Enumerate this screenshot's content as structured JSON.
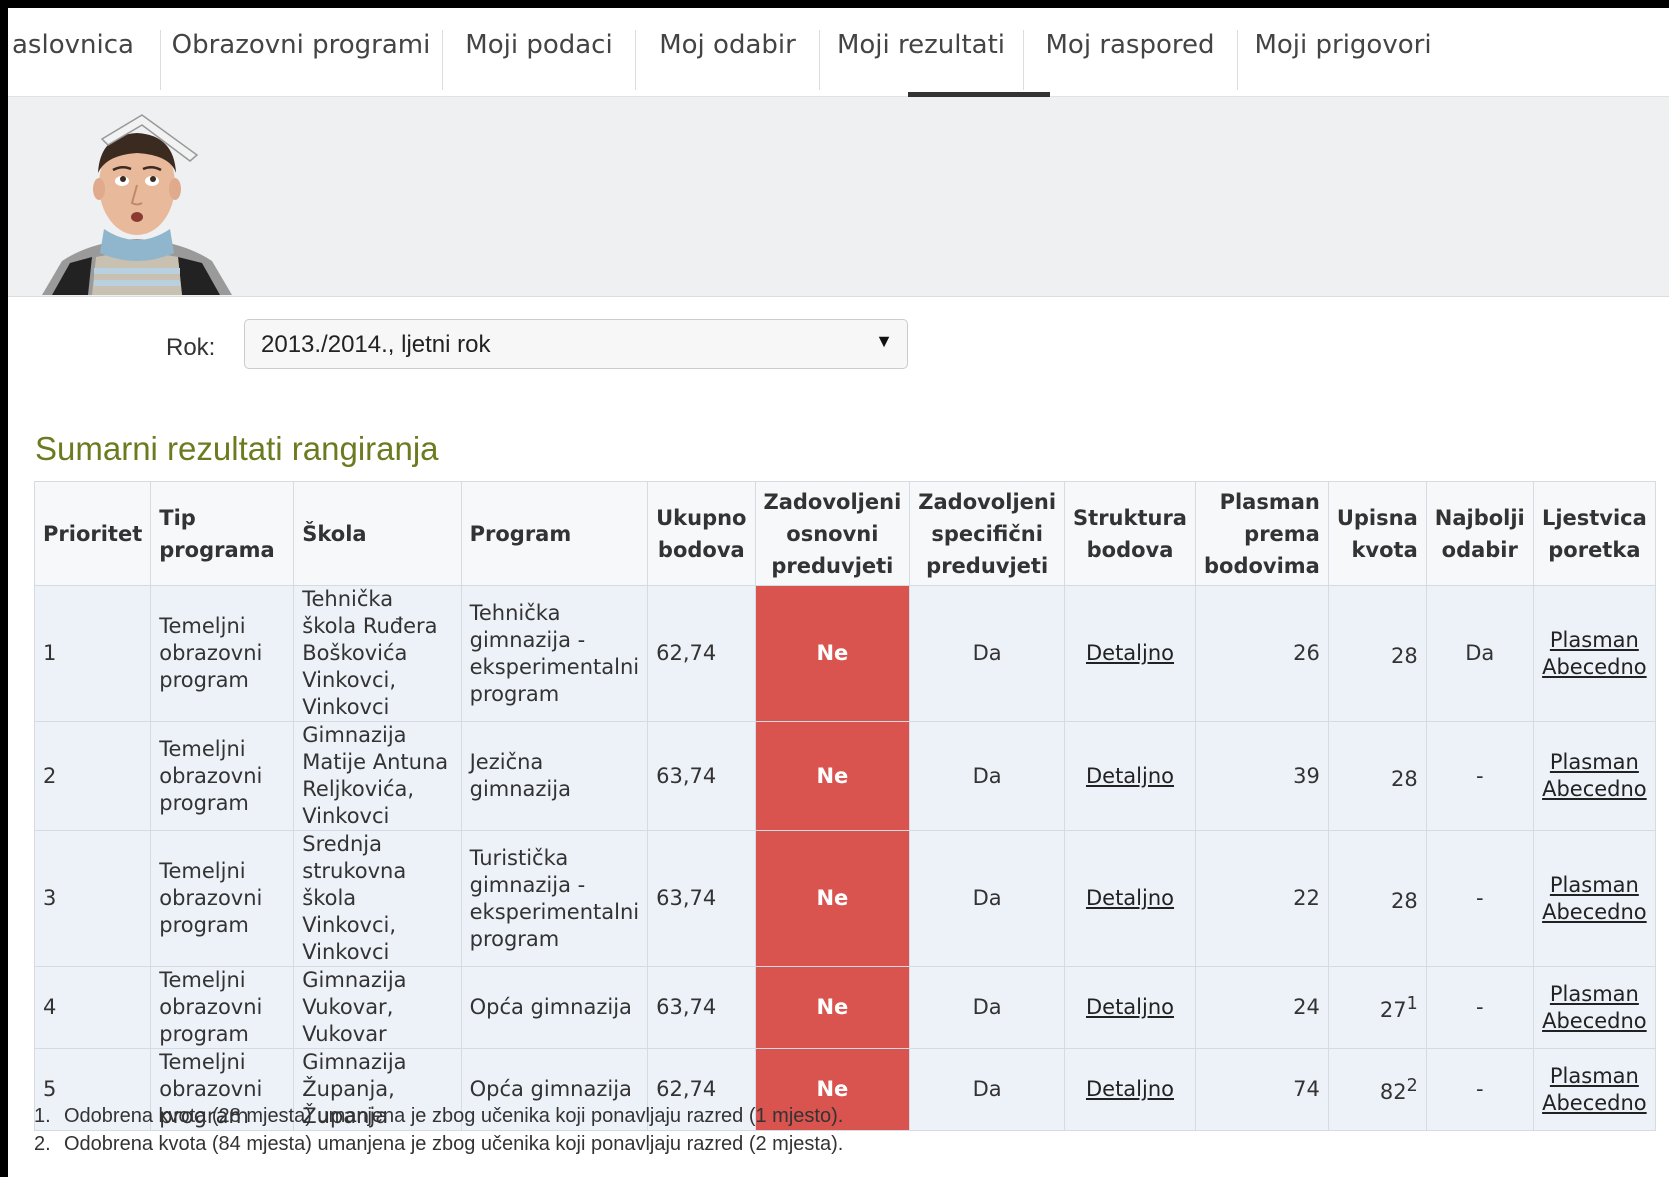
{
  "nav": {
    "tabs": [
      "aslovnica",
      "Obrazovni programi",
      "Moji podaci",
      "Moj odabir",
      "Moji rezultati",
      "Moj raspored",
      "Moji prigovori"
    ],
    "active": "Moji rezultati"
  },
  "filter": {
    "label": "Rok:",
    "selected": "2013./2014., ljetni rok"
  },
  "section_title": "Sumarni rezultati rangiranja",
  "table": {
    "headers": {
      "prioritet": "Prioritet",
      "tip": "Tip programa",
      "skola": "Škola",
      "program": "Program",
      "ukupno": "Ukupno bodova",
      "osnovni": "Zadovoljeni osnovni preduvjeti",
      "specificni": "Zadovoljeni specifični preduvjeti",
      "struktura": "Struktura bodova",
      "plasman": "Plasman prema bodovima",
      "kvota": "Upisna kvota",
      "najbolji": "Najbolji odabir",
      "ljestvica": "Ljestvica poretka"
    },
    "rows": [
      {
        "prioritet": "1",
        "tip": "Temeljni obrazovni program",
        "skola": "Tehnička škola Ruđera Boškovića Vinkovci, Vinkovci",
        "program": "Tehnička gimnazija - eksperimentalni program",
        "ukupno": "62,74",
        "osnovni": "Ne",
        "specificni": "Da",
        "struktura": "Detaljno",
        "plasman": "26",
        "kvota": "28",
        "kvota_sup": "",
        "najbolji": "Da",
        "plasman_link": "Plasman",
        "abecedno_link": "Abecedno"
      },
      {
        "prioritet": "2",
        "tip": "Temeljni obrazovni program",
        "skola": "Gimnazija Matije Antuna Reljkovića, Vinkovci",
        "program": "Jezična gimnazija",
        "ukupno": "63,74",
        "osnovni": "Ne",
        "specificni": "Da",
        "struktura": "Detaljno",
        "plasman": "39",
        "kvota": "28",
        "kvota_sup": "",
        "najbolji": "-",
        "plasman_link": "Plasman",
        "abecedno_link": "Abecedno"
      },
      {
        "prioritet": "3",
        "tip": "Temeljni obrazovni program",
        "skola": "Srednja strukovna škola Vinkovci, Vinkovci",
        "program": "Turistička gimnazija - eksperimentalni program",
        "ukupno": "63,74",
        "osnovni": "Ne",
        "specificni": "Da",
        "struktura": "Detaljno",
        "plasman": "22",
        "kvota": "28",
        "kvota_sup": "",
        "najbolji": "-",
        "plasman_link": "Plasman",
        "abecedno_link": "Abecedno"
      },
      {
        "prioritet": "4",
        "tip": "Temeljni obrazovni program",
        "skola": "Gimnazija Vukovar, Vukovar",
        "program": "Opća gimnazija",
        "ukupno": "63,74",
        "osnovni": "Ne",
        "specificni": "Da",
        "struktura": "Detaljno",
        "plasman": "24",
        "kvota": "27",
        "kvota_sup": "1",
        "najbolji": "-",
        "plasman_link": "Plasman",
        "abecedno_link": "Abecedno"
      },
      {
        "prioritet": "5",
        "tip": "Temeljni obrazovni program",
        "skola": "Gimnazija Županja, Županja",
        "program": "Opća gimnazija",
        "ukupno": "62,74",
        "osnovni": "Ne",
        "specificni": "Da",
        "struktura": "Detaljno",
        "plasman": "74",
        "kvota": "82",
        "kvota_sup": "2",
        "najbolji": "-",
        "plasman_link": "Plasman",
        "abecedno_link": "Abecedno"
      }
    ]
  },
  "footnotes": [
    {
      "num": "1.",
      "text": "Odobrena kvota (28 mjesta) umanjena je zbog učenika koji ponavljaju razred (1 mjesto)."
    },
    {
      "num": "2.",
      "text": "Odobrena kvota (84 mjesta) umanjena je zbog učenika koji ponavljaju razred (2 mjesta)."
    }
  ],
  "colors": {
    "accent_green": "#6b7b1f",
    "ne_red": "#d9534f",
    "row_bg": "#edf1f8"
  }
}
